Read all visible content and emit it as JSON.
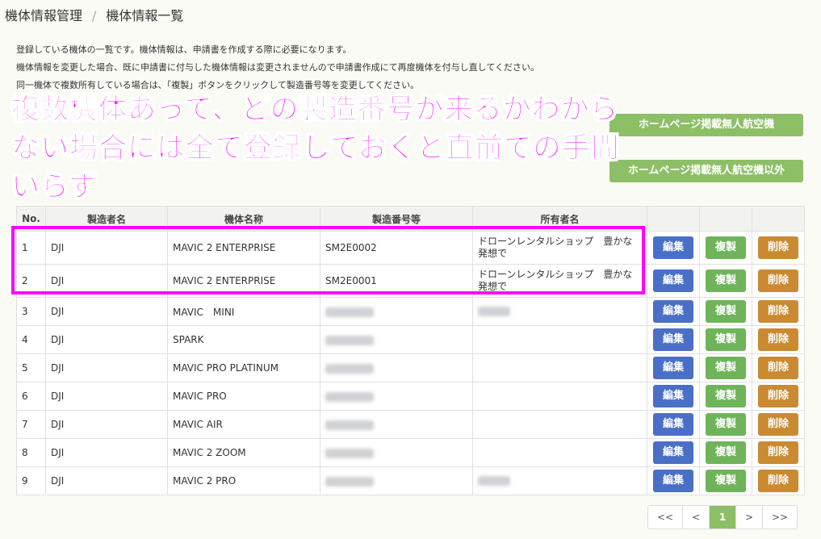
{
  "breadcrumb": {
    "parent": "機体情報管理",
    "separator": "/",
    "current": "機体情報一覧"
  },
  "intro": [
    "登録している機体の一覧です。機体情報は、申請書を作成する際に必要になります。",
    "機体情報を変更した場合、既に申請書に付与した機体情報は変更されませんので申請書作成にて再度機体を付与し直してください。",
    "同一機体で複数所有している場合は、「複製」ボタンをクリックして製造番号等を変更してください。"
  ],
  "buttons": {
    "hp_listed": "ホームページ掲載無人航空機",
    "hp_other": "ホームページ掲載無人航空機以外"
  },
  "annotation": {
    "line1": "複数機体あって、どの製造番号が来るかわから",
    "line2": "ない場合には全て登録しておくと直前での手間",
    "line3": "いらず",
    "color": "#ff00ff"
  },
  "table": {
    "headers": [
      "No.",
      "製造者名",
      "機体名称",
      "製造番号等",
      "所有者名",
      "",
      "",
      ""
    ],
    "action_labels": {
      "edit": "編集",
      "copy": "複製",
      "delete": "削除"
    },
    "rows": [
      {
        "no": "1",
        "maker": "DJI",
        "model": "MAVIC 2 ENTERPRISE",
        "serial": "SM2E0002",
        "owner": "ドローンレンタルショップ　豊かな発想で"
      },
      {
        "no": "2",
        "maker": "DJI",
        "model": "MAVIC 2 ENTERPRISE",
        "serial": "SM2E0001",
        "owner": "ドローンレンタルショップ　豊かな発想で"
      },
      {
        "no": "3",
        "maker": "DJI",
        "model": "MAVIC　MINI",
        "serial": "",
        "owner": ""
      },
      {
        "no": "4",
        "maker": "DJI",
        "model": "SPARK",
        "serial": "",
        "owner": ""
      },
      {
        "no": "5",
        "maker": "DJI",
        "model": "MAVIC PRO PLATINUM",
        "serial": "",
        "owner": ""
      },
      {
        "no": "6",
        "maker": "DJI",
        "model": "MAVIC PRO",
        "serial": "",
        "owner": ""
      },
      {
        "no": "7",
        "maker": "DJI",
        "model": "MAVIC AIR",
        "serial": "",
        "owner": ""
      },
      {
        "no": "8",
        "maker": "DJI",
        "model": "MAVIC 2 ZOOM",
        "serial": "",
        "owner": ""
      },
      {
        "no": "9",
        "maker": "DJI",
        "model": "MAVIC 2 PRO",
        "serial": "",
        "owner": ""
      }
    ]
  },
  "pagination": {
    "first": "<<",
    "prev": "<",
    "current": "1",
    "next": ">",
    "last": ">>"
  },
  "colors": {
    "green": "#8dbf66",
    "edit": "#4a6fc6",
    "copy": "#6fb45a",
    "delete": "#c98a32",
    "highlight": "#ff00ff"
  }
}
